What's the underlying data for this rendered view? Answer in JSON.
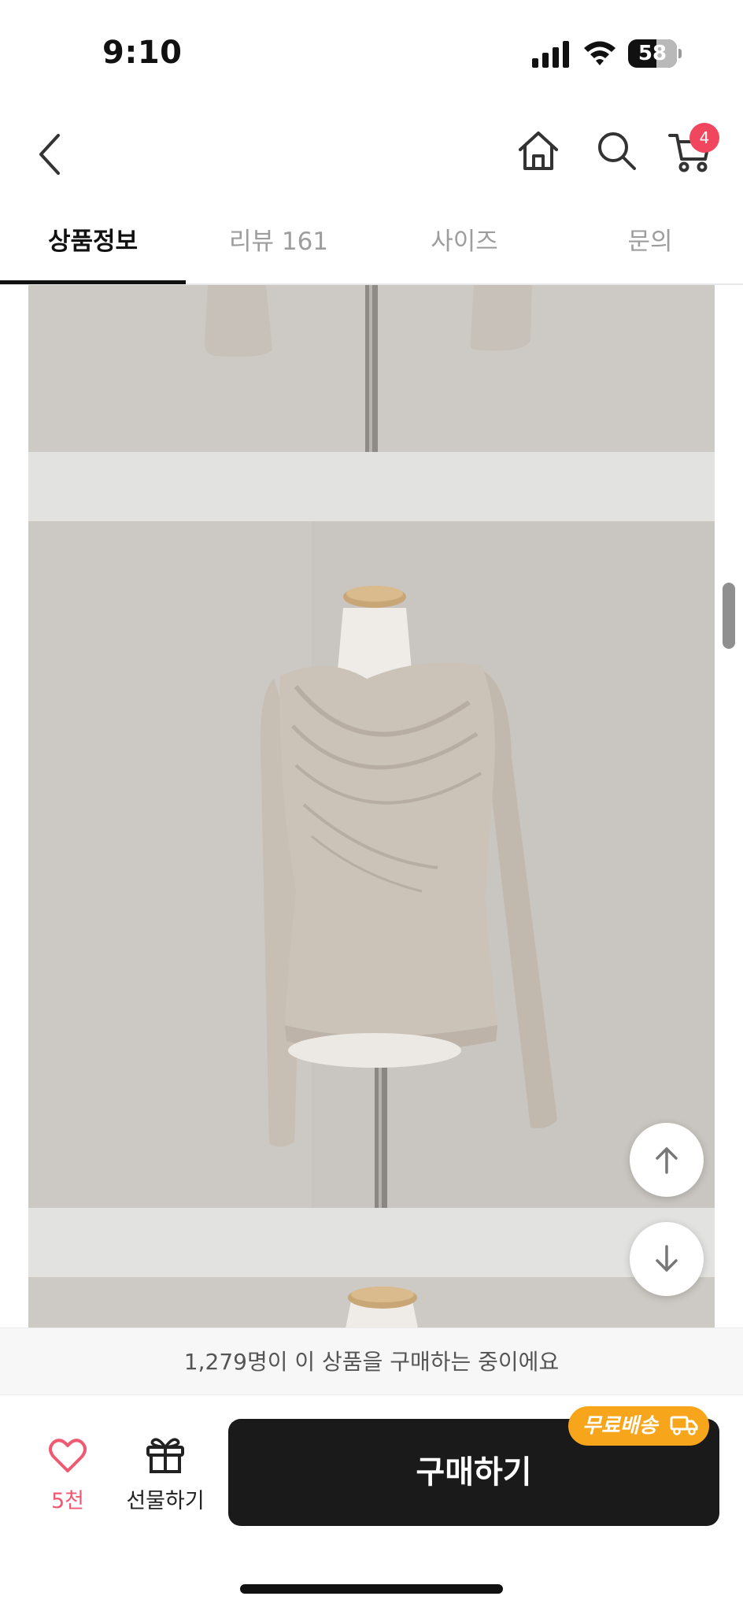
{
  "status_bar": {
    "time": "9:10",
    "battery": "58"
  },
  "header": {
    "icons": [
      "back-icon",
      "home-icon",
      "search-icon",
      "cart-icon"
    ],
    "cart_badge": "4"
  },
  "tabs": [
    {
      "label": "상품정보",
      "active": true
    },
    {
      "label": "리뷰 161",
      "active": false
    },
    {
      "label": "사이즈",
      "active": false
    },
    {
      "label": "문의",
      "active": false
    }
  ],
  "content": {
    "images": [
      "product-photo-top",
      "product-photo-main",
      "product-photo-bottom"
    ],
    "scroll_buttons": [
      "scroll-up",
      "scroll-down"
    ]
  },
  "social_proof": "1,279명이 이 상품을 구매하는 중이에요",
  "bottom_bar": {
    "like_count": "5천",
    "gift_label": "선물하기",
    "buy_label": "구매하기",
    "free_shipping": "무료배송"
  },
  "colors": {
    "accent_pink": "#f0475e",
    "like_pink": "#ef5a72",
    "shipping_orange": "#f7a51a",
    "buy_button": "#1a1a1a"
  }
}
